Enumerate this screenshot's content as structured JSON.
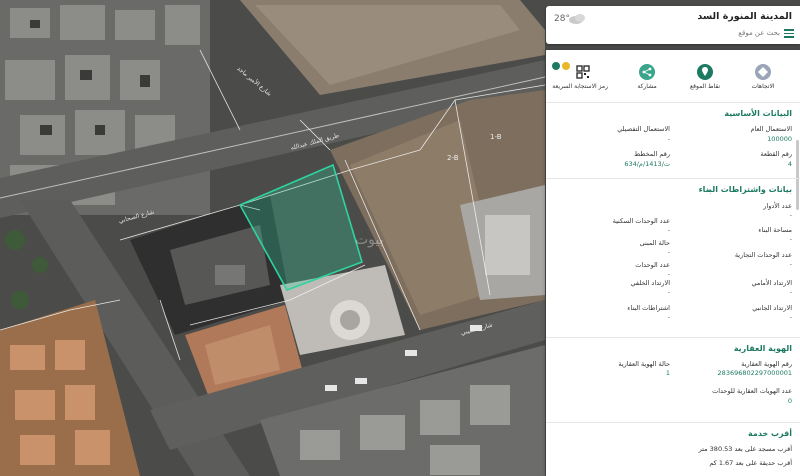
{
  "search": {
    "city": "المدينة المنورة السد",
    "hint": "بحث عن موقع",
    "temperature": "28°"
  },
  "map": {
    "parcel_labels": [
      "1-B",
      "2-B"
    ],
    "road_labels": [
      "شارع الأمير ماجد",
      "طريق الملك عبدالله",
      "شارع الصحابي",
      "شارع الشيبي"
    ],
    "watermark": "بيوت",
    "highlight_color": "#2fd3a0"
  },
  "panel": {
    "actions": [
      {
        "label": "رمز الاستجابة السريعة",
        "icon": "qr-code-icon",
        "color": "#222222"
      },
      {
        "label": "مشاركة",
        "icon": "share-icon",
        "color": "#3aa58a"
      },
      {
        "label": "نقاط الموقع",
        "icon": "location-icon",
        "color": "#1d7a62"
      },
      {
        "label": "الاتجاهات",
        "icon": "directions-icon",
        "color": "#9aa6b8"
      }
    ],
    "basic": {
      "title": "البيانات الأساسية",
      "general_use_label": "الاستعمال العام",
      "general_use_value": "100000",
      "detailed_use_label": "الاستعمال التفصيلي",
      "detailed_use_value": "-",
      "plot_no_label": "رقم القطعة",
      "plot_no_value": "4",
      "plan_no_label": "رقم المخطط",
      "plan_no_value": "ت/1413/م/634"
    },
    "building": {
      "title": "بيانات واشتراطات البناء",
      "floors_label": "عدد الأدوار",
      "floors_value": "-",
      "res_units_label": "عدد الوحدات السكنية",
      "res_units_value": "-",
      "build_area_label": "مساحة البناء",
      "build_area_value": "-",
      "building_status_label": "حالة المبنى",
      "building_status_value": "-",
      "commercial_units_label": "عدد الوحدات التجارية",
      "commercial_units_value": "-",
      "units_label": "عدد الوحدات",
      "units_value": "-",
      "front_setback_label": "الارتداد الأمامي",
      "front_setback_value": "-",
      "back_setback_label": "الارتداد الخلفي",
      "back_setback_value": "-",
      "side_setback_label": "الارتداد الجانبي",
      "side_setback_value": "-",
      "conditions_label": "اشتراطات البناء",
      "conditions_value": "-"
    },
    "identity": {
      "title": "الهوية العقارية",
      "id_label": "رقم الهوية العقارية",
      "id_value": "283696802297000001",
      "status_label": "حالة الهوية العقارية",
      "status_value": "1",
      "units_label": "عدد الهويات العقارية للوحدات",
      "units_value": "0"
    },
    "nearest": {
      "title": "أقرب خدمة",
      "mosque": "أقرب مسجد على بعد 380.53 متر",
      "park": "أقرب حديقة على بعد 1.67 كم"
    }
  }
}
